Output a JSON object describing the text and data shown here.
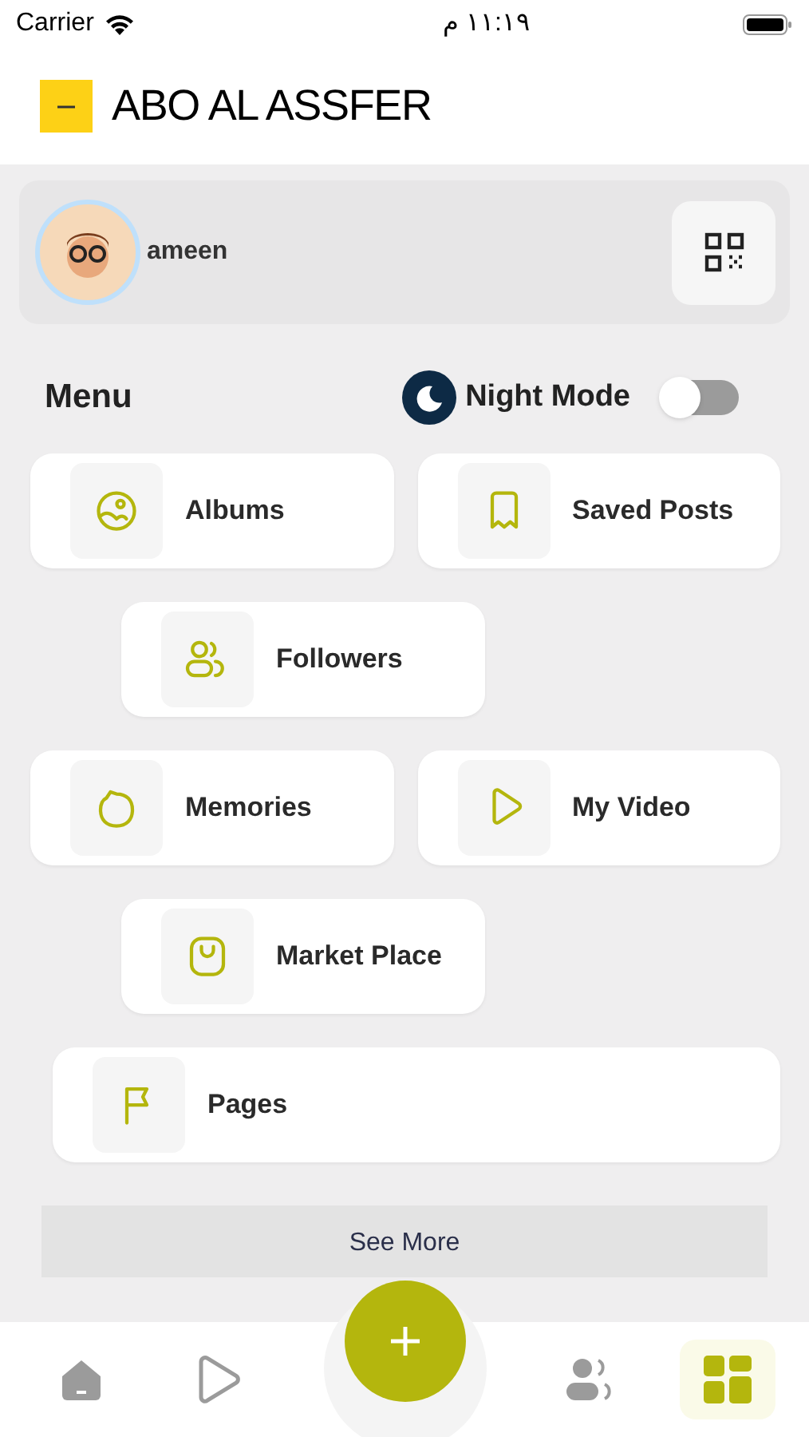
{
  "status_bar": {
    "carrier": "Carrier",
    "time": "١١:١٩ م"
  },
  "header": {
    "title": "ABO AL ASSFER"
  },
  "profile": {
    "name": "ameen"
  },
  "menu": {
    "title": "Menu",
    "night_mode": {
      "label": "Night Mode",
      "on": false
    }
  },
  "menu_rows": [
    [
      {
        "label": "Albums",
        "kind": "image"
      },
      {
        "label": "Saved Posts",
        "kind": "bookmark"
      }
    ],
    [
      {
        "label": "Followers",
        "kind": "people"
      }
    ],
    [
      {
        "label": "Memories",
        "kind": "blob"
      },
      {
        "label": "My Video",
        "kind": "play"
      }
    ],
    [
      {
        "label": "Market Place",
        "kind": "bag"
      }
    ],
    [
      {
        "label": "Pages",
        "kind": "flag"
      }
    ]
  ],
  "see_more": "See More",
  "tab_bar": [
    {
      "kind": "home",
      "selected": false
    },
    {
      "kind": "play",
      "selected": false
    },
    {
      "kind": "people",
      "selected": false
    },
    {
      "kind": "grid",
      "selected": true
    }
  ]
}
